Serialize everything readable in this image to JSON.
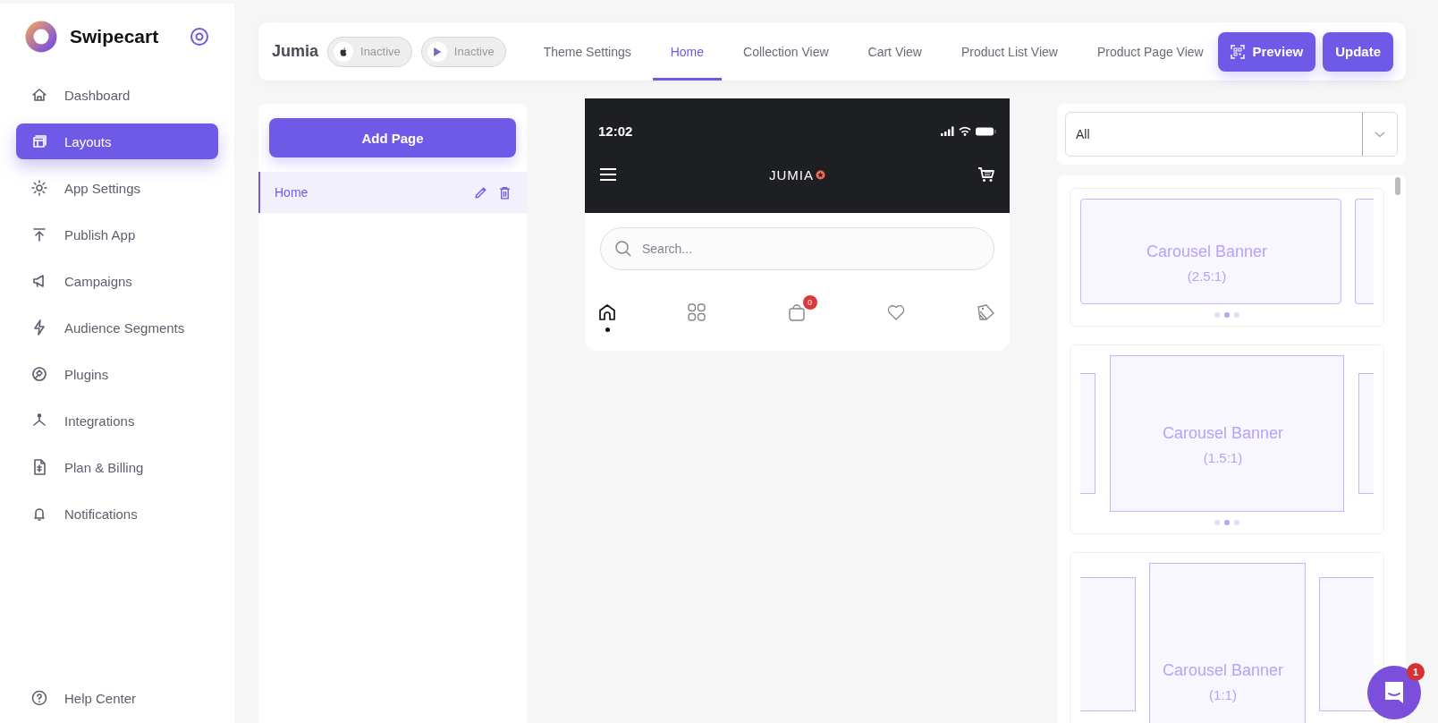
{
  "brand": {
    "name": "Swipecart"
  },
  "sidebar": {
    "items": [
      {
        "label": "Dashboard",
        "selected": false
      },
      {
        "label": "Layouts",
        "selected": true
      },
      {
        "label": "App Settings",
        "selected": false
      },
      {
        "label": "Publish App",
        "selected": false
      },
      {
        "label": "Campaigns",
        "selected": false
      },
      {
        "label": "Audience Segments",
        "selected": false
      },
      {
        "label": "Plugins",
        "selected": false
      },
      {
        "label": "Integrations",
        "selected": false
      },
      {
        "label": "Plan & Billing",
        "selected": false
      },
      {
        "label": "Notifications",
        "selected": false
      }
    ],
    "footer": {
      "label": "Help Center"
    }
  },
  "topbar": {
    "store": "Jumia",
    "platforms": [
      {
        "kind": "ios",
        "status": "Inactive"
      },
      {
        "kind": "android",
        "status": "Inactive"
      }
    ],
    "tabs": [
      {
        "label": "Theme Settings",
        "selected": false
      },
      {
        "label": "Home",
        "selected": true
      },
      {
        "label": "Collection View",
        "selected": false
      },
      {
        "label": "Cart View",
        "selected": false
      },
      {
        "label": "Product List View",
        "selected": false
      },
      {
        "label": "Product Page View",
        "selected": false
      }
    ],
    "buttons": [
      {
        "kind": "preview",
        "label": "Preview"
      },
      {
        "kind": "update",
        "label": "Update"
      }
    ]
  },
  "pages": {
    "add_button": "Add Page",
    "items": [
      {
        "label": "Home",
        "selected": true
      }
    ]
  },
  "phone": {
    "time": "12:02",
    "logo": "JUMIA",
    "search_placeholder": "Search...",
    "nav": [
      {
        "kind": "home",
        "selected": true
      },
      {
        "kind": "categories",
        "selected": false
      },
      {
        "kind": "bag",
        "selected": false,
        "badge": "0"
      },
      {
        "kind": "wishlist",
        "selected": false
      },
      {
        "kind": "offers",
        "selected": false
      }
    ]
  },
  "widgets": {
    "filter": "All",
    "items": [
      {
        "kind": "wide",
        "title": "Carousel Banner",
        "ratio": "(2.5:1)"
      },
      {
        "kind": "medium",
        "title": "Carousel Banner",
        "ratio": "(1.5:1)"
      },
      {
        "kind": "square",
        "title": "Carousel Banner",
        "ratio": "(1:1)"
      }
    ]
  },
  "chat": {
    "badge": "1"
  }
}
